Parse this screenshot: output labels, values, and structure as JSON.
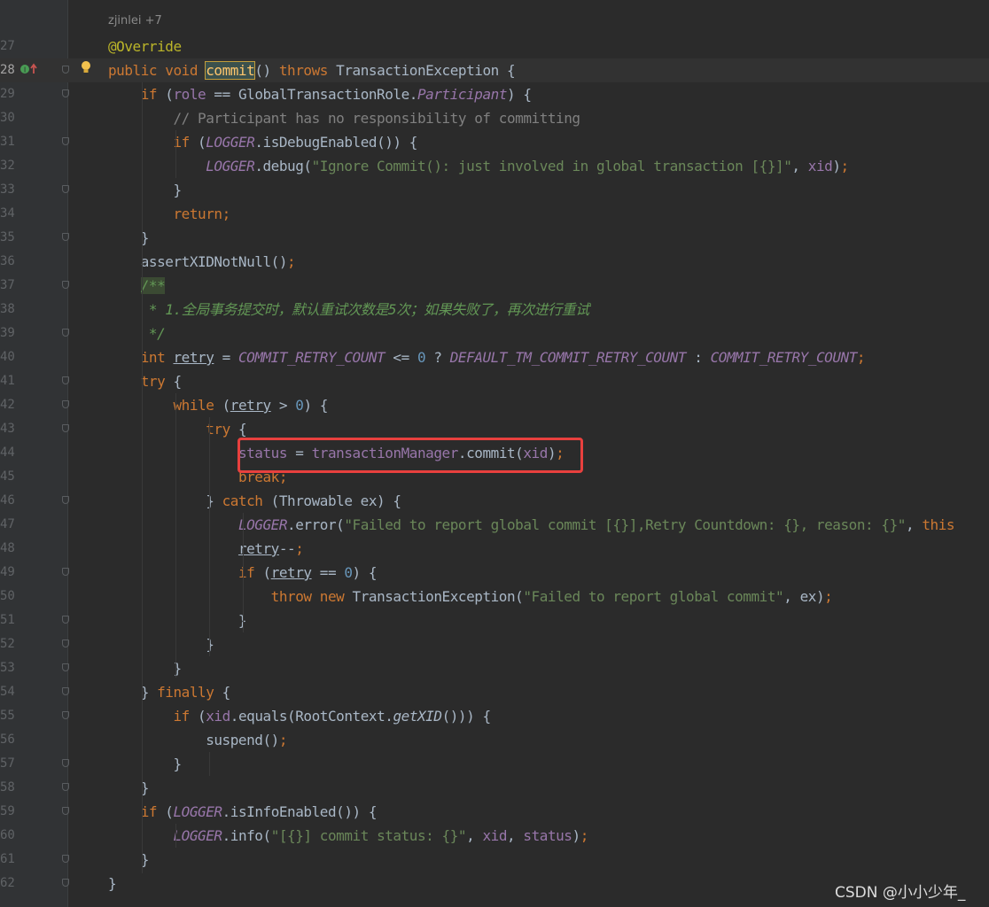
{
  "editor": {
    "author_hint": "zjinlei +7",
    "lines": [
      {
        "n": "27",
        "html": "<span class='ann'>@Override</span>"
      },
      {
        "n": "28",
        "html": "<span class='kw'>public void </span><span class='fn hl'>commit</span>() <span class='kw'>throws </span>TransactionException {"
      },
      {
        "n": "29",
        "html": "    <span class='kw'>if </span>(<span class='fld'>role</span> == GlobalTransactionRole.<span class='cst'>Participant</span>) {"
      },
      {
        "n": "30",
        "html": "        <span class='cmt'>// Participant has no responsibility of committing</span>"
      },
      {
        "n": "31",
        "html": "        <span class='kw'>if </span>(<span class='cst'>LOGGER</span>.isDebugEnabled()) {"
      },
      {
        "n": "32",
        "html": "            <span class='cst'>LOGGER</span>.debug(<span class='str'>\"Ignore Commit(): just involved in global transaction [{}]\"</span>, <span class='fld'>xid</span>)<span class='kw'>;</span>"
      },
      {
        "n": "33",
        "html": "        }"
      },
      {
        "n": "34",
        "html": "        <span class='kw'>return;</span>"
      },
      {
        "n": "35",
        "html": "    }"
      },
      {
        "n": "36",
        "html": "    assertXIDNotNull()<span class='kw'>;</span>"
      },
      {
        "n": "37",
        "html": "    <span class='docbg'>/**</span>"
      },
      {
        "n": "38",
        "html": "     <span class='doc'>* 1.全局事务提交时，默认重试次数是5次；如果失败了，再次进行重试</span>"
      },
      {
        "n": "39",
        "html": "     <span class='doc'>*/</span>"
      },
      {
        "n": "40",
        "html": "    <span class='kw'>int </span><span class='ul'>retry</span> = <span class='cst'>COMMIT_RETRY_COUNT</span> &lt;= <span class='num'>0</span> ? <span class='cst'>DEFAULT_TM_COMMIT_RETRY_COUNT</span> : <span class='cst'>COMMIT_RETRY_COUNT</span><span class='kw'>;</span>"
      },
      {
        "n": "41",
        "html": "    <span class='kw'>try </span>{"
      },
      {
        "n": "42",
        "html": "        <span class='kw'>while </span>(<span class='ul'>retry</span> &gt; <span class='num'>0</span>) {"
      },
      {
        "n": "43",
        "html": "            <span class='kw'>try </span>{"
      },
      {
        "n": "44",
        "html": "                <span class='fld'>status</span> = <span class='fld'>transactionManager</span>.commit(<span class='fld'>xid</span>)<span class='kw'>;</span>"
      },
      {
        "n": "45",
        "html": "                <span class='kw'>break;</span>"
      },
      {
        "n": "46",
        "html": "            } <span class='kw'>catch </span>(Throwable ex) {"
      },
      {
        "n": "47",
        "html": "                <span class='cst'>LOGGER</span>.error(<span class='str'>\"Failed to report global commit [{}],Retry Countdown: {}, reason: {}\"</span>, <span class='kw'>this</span>"
      },
      {
        "n": "48",
        "html": "                <span class='ul'>retry</span>--<span class='kw'>;</span>"
      },
      {
        "n": "49",
        "html": "                <span class='kw'>if </span>(<span class='ul'>retry</span> == <span class='num'>0</span>) {"
      },
      {
        "n": "50",
        "html": "                    <span class='kw'>throw new </span>TransactionException(<span class='str'>\"Failed to report global commit\"</span>, ex)<span class='kw'>;</span>"
      },
      {
        "n": "51",
        "html": "                }"
      },
      {
        "n": "52",
        "html": "            }"
      },
      {
        "n": "53",
        "html": "        }"
      },
      {
        "n": "54",
        "html": "    } <span class='kw'>finally </span>{"
      },
      {
        "n": "55",
        "html": "        <span class='kw'>if </span>(<span class='fld'>xid</span>.equals(RootContext.<span style='font-style:italic'>getXID</span>())) {"
      },
      {
        "n": "56",
        "html": "            suspend()<span class='kw'>;</span>"
      },
      {
        "n": "57",
        "html": "        }"
      },
      {
        "n": "58",
        "html": "    }"
      },
      {
        "n": "59",
        "html": "    <span class='kw'>if </span>(<span class='cst'>LOGGER</span>.isInfoEnabled()) {"
      },
      {
        "n": "60",
        "html": "        <span class='cst'>LOGGER</span>.info(<span class='str'>\"[{}] commit status: {}\"</span>, <span class='fld'>xid</span>, <span class='fld'>status</span>)<span class='kw'>;</span>"
      },
      {
        "n": "61",
        "html": "    }"
      },
      {
        "n": "62",
        "html": "}"
      }
    ],
    "current_line": "28"
  },
  "watermark": "CSDN @小小少年_",
  "colors": {
    "background": "#2b2b2b",
    "keyword": "#cc7832",
    "string": "#6a8759",
    "field": "#9876aa",
    "highlight_box": "#e8403e"
  }
}
